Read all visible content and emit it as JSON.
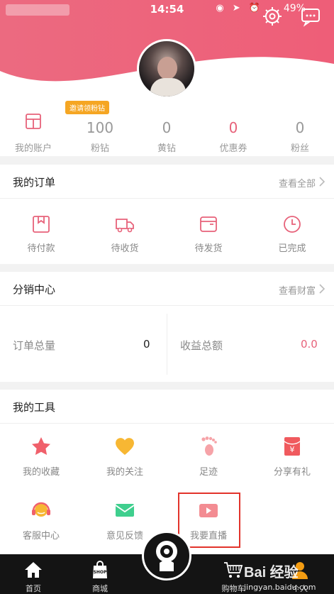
{
  "statusbar": {
    "time": "14:54",
    "battery": "49%"
  },
  "stats": {
    "invite_badge": "邀请领粉钻",
    "items": [
      {
        "value": "",
        "label": "我的账户"
      },
      {
        "value": "100",
        "label": "粉钻"
      },
      {
        "value": "0",
        "label": "黄钻"
      },
      {
        "value": "0",
        "label": "优惠券"
      },
      {
        "value": "0",
        "label": "粉丝"
      }
    ]
  },
  "orders": {
    "title": "我的订单",
    "more": "查看全部",
    "items": [
      {
        "label": "待付款",
        "icon": "wallet-icon"
      },
      {
        "label": "待收货",
        "icon": "truck-icon"
      },
      {
        "label": "待发货",
        "icon": "package-icon"
      },
      {
        "label": "已完成",
        "icon": "clock-icon"
      }
    ]
  },
  "distribution": {
    "title": "分销中心",
    "more": "查看财富",
    "order_total_label": "订单总量",
    "order_total_value": "0",
    "income_label": "收益总额",
    "income_value": "0.0"
  },
  "tools": {
    "title": "我的工具",
    "items": [
      {
        "label": "我的收藏",
        "icon": "star-icon"
      },
      {
        "label": "我的关注",
        "icon": "heart-icon"
      },
      {
        "label": "足迹",
        "icon": "footprint-icon"
      },
      {
        "label": "分享有礼",
        "icon": "red-envelope-icon"
      },
      {
        "label": "客服中心",
        "icon": "headset-icon"
      },
      {
        "label": "意见反馈",
        "icon": "mail-icon"
      },
      {
        "label": "我要直播",
        "icon": "video-camera-icon"
      }
    ]
  },
  "tabbar": {
    "items": [
      {
        "label": "首页",
        "icon": "home-icon"
      },
      {
        "label": "商城",
        "icon": "shop-bag-icon",
        "bag_text": "SHOP"
      },
      {
        "label": "购物车",
        "icon": "cart-icon"
      },
      {
        "label": "个人",
        "icon": "person-icon"
      }
    ]
  },
  "watermark": {
    "line1": "Bai 经验",
    "line2": "jingyan.baidu.com"
  },
  "colors": {
    "brand": "#ee6179",
    "accent_red": "#e7627a",
    "highlight": "#e2332b"
  }
}
